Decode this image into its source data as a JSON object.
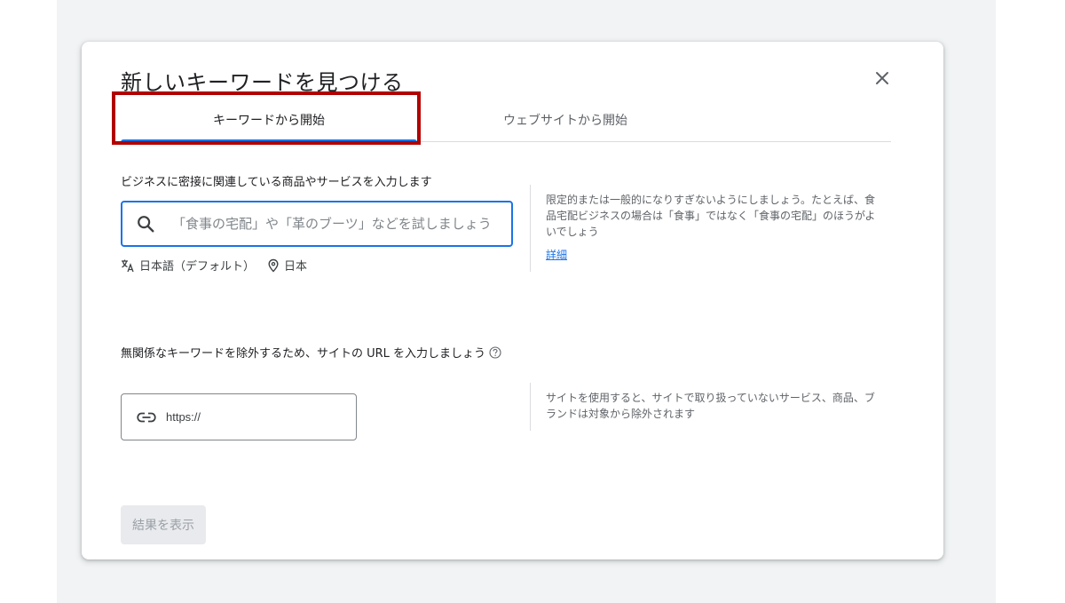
{
  "dialog": {
    "title": "新しいキーワードを見つける",
    "close_icon": "close-icon"
  },
  "tabs": [
    {
      "label": "キーワードから開始",
      "selected": true
    },
    {
      "label": "ウェブサイトから開始",
      "selected": false
    }
  ],
  "keyword_section": {
    "label": "ビジネスに密接に関連している商品やサービスを入力します",
    "search_placeholder": "「食事の宅配」や「革のブーツ」などを試しましょう",
    "search_value": "",
    "language": "日本語（デフォルト）",
    "location": "日本",
    "tip": "限定的または一般的になりすぎないようにしましょう。たとえば、食品宅配ビジネスの場合は「食事」ではなく「食事の宅配」のほうがよいでしょう",
    "tip_link": "詳細"
  },
  "url_section": {
    "label": "無関係なキーワードを除外するため、サイトの URL を入力しましょう",
    "url_placeholder": "https://",
    "tip": "サイトを使用すると、サイトで取り扱っていないサービス、商品、ブランドは対象から除外されます"
  },
  "actions": {
    "submit_label": "結果を表示",
    "submit_enabled": false
  },
  "colors": {
    "accent": "#1a73e8",
    "highlight": "#b20000",
    "disabled_bg": "#e8eaed",
    "disabled_text": "#9aa0a6"
  }
}
